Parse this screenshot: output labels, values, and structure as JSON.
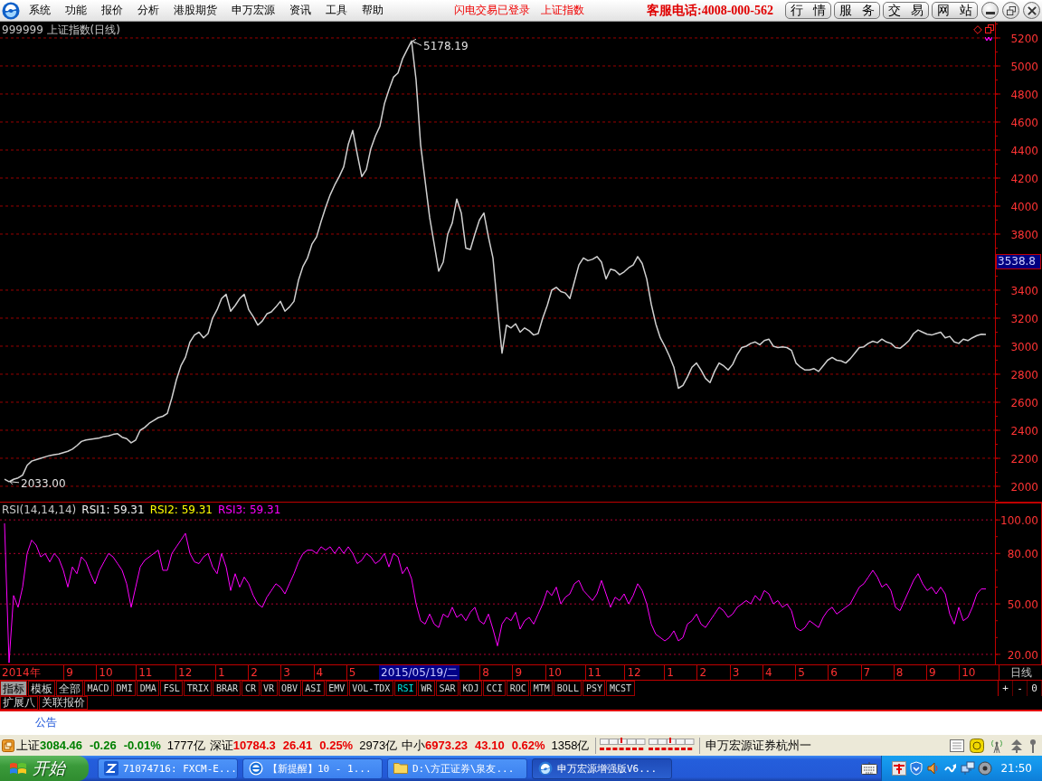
{
  "menu_bar": {
    "items": [
      "系统",
      "功能",
      "报价",
      "分析",
      "港股期货",
      "申万宏源",
      "资讯",
      "工具",
      "帮助"
    ],
    "notices": [
      "闪电交易已登录",
      "上证指数"
    ],
    "hotline": "客服电话:4008-000-562",
    "buttons": [
      "行 情",
      "服 务",
      "交 易",
      "网 站"
    ]
  },
  "price_panel": {
    "chart_data": {
      "type": "line",
      "title": "999999 上证指数(日线)",
      "grid": true,
      "ylim": [
        1890,
        5316
      ],
      "yticks": [
        2000,
        2200,
        2400,
        2600,
        2800,
        3000,
        3200,
        3400,
        3800,
        4000,
        4200,
        4400,
        4600,
        4800,
        5000,
        5200
      ],
      "series": [
        {
          "color": "#d0d0d0",
          "values": [
            2050,
            2033,
            2050,
            2060,
            2080,
            2150,
            2180,
            2190,
            2200,
            2210,
            2220,
            2225,
            2230,
            2240,
            2250,
            2265,
            2290,
            2320,
            2330,
            2335,
            2340,
            2345,
            2355,
            2360,
            2370,
            2375,
            2350,
            2340,
            2310,
            2330,
            2400,
            2420,
            2450,
            2470,
            2490,
            2500,
            2520,
            2630,
            2760,
            2860,
            2920,
            3030,
            3080,
            3100,
            3060,
            3090,
            3200,
            3260,
            3340,
            3370,
            3250,
            3290,
            3340,
            3370,
            3260,
            3210,
            3150,
            3180,
            3230,
            3245,
            3280,
            3320,
            3250,
            3280,
            3320,
            3470,
            3570,
            3630,
            3730,
            3780,
            3890,
            3990,
            4080,
            4150,
            4210,
            4280,
            4440,
            4540,
            4370,
            4210,
            4260,
            4410,
            4500,
            4570,
            4730,
            4830,
            4920,
            4950,
            5050,
            5115,
            5178,
            4900,
            4440,
            4180,
            3920,
            3730,
            3535,
            3600,
            3800,
            3880,
            4050,
            3950,
            3700,
            3690,
            3800,
            3900,
            3950,
            3780,
            3630,
            3280,
            2950,
            3150,
            3130,
            3160,
            3100,
            3130,
            3110,
            3080,
            3090,
            3200,
            3290,
            3400,
            3420,
            3390,
            3380,
            3340,
            3460,
            3580,
            3630,
            3610,
            3620,
            3640,
            3600,
            3480,
            3550,
            3540,
            3510,
            3530,
            3560,
            3580,
            3640,
            3590,
            3480,
            3300,
            3160,
            3060,
            3000,
            2930,
            2850,
            2700,
            2720,
            2780,
            2850,
            2880,
            2830,
            2770,
            2740,
            2820,
            2880,
            2860,
            2830,
            2870,
            2940,
            2990,
            3000,
            3020,
            3030,
            3010,
            3040,
            3050,
            3000,
            2990,
            2995,
            2990,
            2970,
            2880,
            2850,
            2830,
            2830,
            2840,
            2820,
            2860,
            2900,
            2920,
            2900,
            2895,
            2880,
            2910,
            2950,
            2990,
            2995,
            3020,
            3035,
            3025,
            3050,
            3030,
            3020,
            2990,
            2985,
            3010,
            3040,
            3090,
            3115,
            3100,
            3085,
            3080,
            3090,
            3100,
            3060,
            3070,
            3030,
            3020,
            3050,
            3040,
            3060,
            3075,
            3085,
            3084
          ]
        }
      ],
      "annotations": [
        "5178.19",
        "2033.00"
      ]
    },
    "cursor_label": "3538.8"
  },
  "indicator_panel": {
    "legend": [
      {
        "text": "RSI1: 59.31",
        "color": "#f0f0f0"
      },
      {
        "text": "RSI2: 59.31",
        "color": "#ffff00"
      },
      {
        "text": "RSI3: 59.31",
        "color": "#ff00ff"
      }
    ],
    "chart_data": {
      "type": "line",
      "title": "RSI(14,14,14)",
      "grid": true,
      "ylim": [
        13.5,
        110.3
      ],
      "yticks": [
        {
          "value": 20,
          "label": "20.00"
        },
        {
          "value": 50,
          "label": "50.00"
        },
        {
          "value": 80,
          "label": "80.00"
        },
        {
          "value": 100,
          "label": "100.00"
        }
      ],
      "series": [
        {
          "color": "#ff00ff",
          "values": [
            98,
            15,
            55,
            48,
            60,
            80,
            88,
            85,
            78,
            80,
            75,
            80,
            77,
            70,
            60,
            72,
            68,
            78,
            75,
            68,
            62,
            70,
            75,
            80,
            78,
            74,
            70,
            62,
            48,
            60,
            72,
            76,
            78,
            80,
            82,
            70,
            70,
            80,
            84,
            88,
            92,
            80,
            75,
            74,
            78,
            80,
            72,
            68,
            80,
            72,
            58,
            68,
            60,
            66,
            62,
            55,
            50,
            48,
            54,
            58,
            62,
            60,
            56,
            62,
            68,
            75,
            80,
            82,
            82,
            80,
            84,
            82,
            84,
            80,
            84,
            80,
            84,
            80,
            74,
            76,
            80,
            78,
            74,
            76,
            80,
            72,
            80,
            78,
            68,
            72,
            65,
            50,
            40,
            38,
            44,
            38,
            36,
            44,
            42,
            48,
            42,
            44,
            40,
            45,
            48,
            40,
            38,
            44,
            35,
            25,
            38,
            42,
            40,
            45,
            35,
            40,
            42,
            38,
            44,
            50,
            58,
            55,
            60,
            50,
            54,
            56,
            62,
            64,
            58,
            55,
            52,
            56,
            64,
            56,
            48,
            54,
            52,
            56,
            50,
            55,
            62,
            58,
            50,
            38,
            32,
            30,
            28,
            30,
            34,
            28,
            30,
            38,
            40,
            44,
            38,
            36,
            40,
            44,
            48,
            46,
            42,
            44,
            48,
            50,
            52,
            50,
            55,
            52,
            58,
            56,
            50,
            52,
            48,
            50,
            46,
            36,
            34,
            36,
            40,
            38,
            36,
            42,
            46,
            48,
            44,
            46,
            48,
            50,
            55,
            60,
            62,
            66,
            70,
            66,
            60,
            62,
            58,
            48,
            46,
            52,
            58,
            64,
            68,
            62,
            58,
            60,
            56,
            60,
            56,
            44,
            38,
            48,
            40,
            42,
            48,
            56,
            59,
            59
          ]
        }
      ]
    }
  },
  "date_axis": {
    "items": [
      {
        "label": "2014年",
        "kind": "tick"
      },
      {
        "label": "9",
        "kind": "tick"
      },
      {
        "label": "10",
        "kind": "tick"
      },
      {
        "label": "11",
        "kind": "tick"
      },
      {
        "label": "12",
        "kind": "tick"
      },
      {
        "label": "1",
        "kind": "tick"
      },
      {
        "label": "2",
        "kind": "tick"
      },
      {
        "label": "3",
        "kind": "tick"
      },
      {
        "label": "4",
        "kind": "tick"
      },
      {
        "label": "5",
        "kind": "tick"
      },
      {
        "label": "2015/05/19/二",
        "kind": "cursor"
      },
      {
        "label": "8",
        "kind": "tick"
      },
      {
        "label": "9",
        "kind": "tick"
      },
      {
        "label": "10",
        "kind": "tick"
      },
      {
        "label": "11",
        "kind": "tick"
      },
      {
        "label": "12",
        "kind": "tick"
      },
      {
        "label": "1",
        "kind": "tick"
      },
      {
        "label": "2",
        "kind": "tick"
      },
      {
        "label": "3",
        "kind": "tick"
      },
      {
        "label": "4",
        "kind": "tick"
      },
      {
        "label": "5",
        "kind": "tick"
      },
      {
        "label": "6",
        "kind": "tick"
      },
      {
        "label": "7",
        "kind": "tick"
      },
      {
        "label": "8",
        "kind": "tick"
      },
      {
        "label": "9",
        "kind": "tick"
      },
      {
        "label": "10",
        "kind": "tick"
      }
    ],
    "period": "日线"
  },
  "indicator_tabs": [
    {
      "label": "指标",
      "kind": "mode",
      "selected": true
    },
    {
      "label": "模板",
      "kind": "mode",
      "selected": false
    },
    {
      "label": "全部",
      "kind": "mode",
      "selected": false
    },
    {
      "label": "MACD",
      "kind": "indicator",
      "selected": false
    },
    {
      "label": "DMI",
      "kind": "indicator",
      "selected": false
    },
    {
      "label": "DMA",
      "kind": "indicator",
      "selected": false
    },
    {
      "label": "FSL",
      "kind": "indicator",
      "selected": false
    },
    {
      "label": "TRIX",
      "kind": "indicator",
      "selected": false
    },
    {
      "label": "BRAR",
      "kind": "indicator",
      "selected": false
    },
    {
      "label": "CR",
      "kind": "indicator",
      "selected": false
    },
    {
      "label": "VR",
      "kind": "indicator",
      "selected": false
    },
    {
      "label": "OBV",
      "kind": "indicator",
      "selected": false
    },
    {
      "label": "ASI",
      "kind": "indicator",
      "selected": false
    },
    {
      "label": "EMV",
      "kind": "indicator",
      "selected": false
    },
    {
      "label": "VOL-TDX",
      "kind": "indicator",
      "selected": false
    },
    {
      "label": "RSI",
      "kind": "indicator",
      "selected": true
    },
    {
      "label": "WR",
      "kind": "indicator",
      "selected": false
    },
    {
      "label": "SAR",
      "kind": "indicator",
      "selected": false
    },
    {
      "label": "KDJ",
      "kind": "indicator",
      "selected": false
    },
    {
      "label": "CCI",
      "kind": "indicator",
      "selected": false
    },
    {
      "label": "ROC",
      "kind": "indicator",
      "selected": false
    },
    {
      "label": "MTM",
      "kind": "indicator",
      "selected": false
    },
    {
      "label": "BOLL",
      "kind": "indicator",
      "selected": false
    },
    {
      "label": "PSY",
      "kind": "indicator",
      "selected": false
    },
    {
      "label": "MCST",
      "kind": "indicator",
      "selected": false
    }
  ],
  "scale_buttons": [
    "+",
    "-",
    "0"
  ],
  "sub_tabs": [
    "扩展八",
    "关联报价"
  ],
  "notice_bar": {
    "label": "公告"
  },
  "status_bar": {
    "markets": [
      {
        "name": "上证",
        "value": "3084.46",
        "change": "-0.26",
        "percent": "-0.01%",
        "turnover": "1777亿",
        "rising": false
      },
      {
        "name": "深证",
        "value": "10784.3",
        "change": "26.41",
        "percent": "0.25%",
        "turnover": "2973亿",
        "rising": true
      },
      {
        "name": "中小",
        "value": "6973.23",
        "change": "43.10",
        "percent": "0.62%",
        "turnover": "1358亿",
        "rising": true
      }
    ],
    "branch": "申万宏源证券杭州一"
  },
  "taskbar": {
    "start": "开始",
    "tasks": [
      {
        "label": "71074716: FXCM-E...",
        "kind": "app",
        "selected": false
      },
      {
        "label": "【新提醒】10 - 1...",
        "kind": "browser",
        "selected": false
      },
      {
        "label": "D:\\方正证券\\泉友...",
        "kind": "folder",
        "selected": false
      },
      {
        "label": "申万宏源增强版V6...",
        "kind": "trading",
        "selected": true
      }
    ],
    "clock": "21:50"
  }
}
